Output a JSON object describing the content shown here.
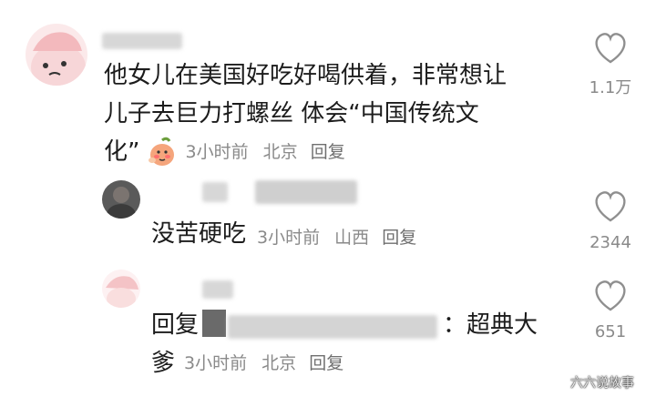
{
  "comments": [
    {
      "text_lines": [
        "他女儿在美国好吃好喝供着，非常想让",
        "儿子去巨力打螺丝 体会“中国传统文",
        "化”"
      ],
      "emoji_icon": "blushing-peach-emoji",
      "time": "3小时前",
      "location": "北京",
      "reply_label": "回复",
      "likes": "1.1万"
    },
    {
      "text": "没苦硬吃",
      "time": "3小时前",
      "location": "山西",
      "reply_label": "回复",
      "likes": "2344"
    },
    {
      "text_line1_prefix": "回复",
      "text_line1_suffix": "：超典大",
      "text_line2": "爹",
      "time": "3小时前",
      "location": "北京",
      "reply_label": "回复",
      "likes": "651"
    }
  ],
  "icons": {
    "like": "heart-outline-icon"
  },
  "watermark": "六六说故事"
}
